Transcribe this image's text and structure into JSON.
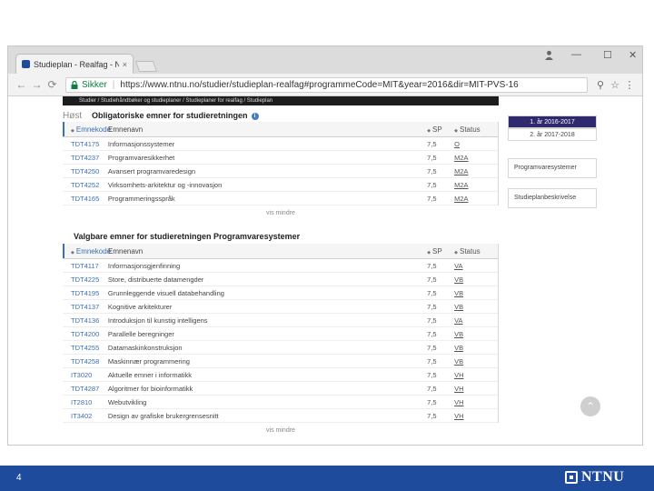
{
  "browser": {
    "tab_title": "Studieplan - Realfag - N",
    "tab_close": "×",
    "window_controls": [
      "—",
      "☐",
      "✕"
    ],
    "nav": {
      "back": "←",
      "forward": "→",
      "reload": "⟳"
    },
    "address": {
      "secure_label": "Sikker",
      "url": "https://www.ntnu.no/studier/studieplan-realfag#programmeCode=MIT&year=2016&dir=MIT-PVS-16"
    },
    "toolbar_icons": {
      "zoom": "⚲",
      "bookmark": "☆",
      "menu": "⋮"
    }
  },
  "page": {
    "breadcrumb": "Studier / Studiehåndbøker og studieplaner / Studieplaner for realfag / Studieplan",
    "season": "Høst",
    "mandatory": {
      "title": "Obligatoriske emner for studieretningen",
      "columns": {
        "code": "Emnekode",
        "name": "Emnenavn",
        "sp": "SP",
        "status": "Status"
      },
      "rows": [
        {
          "code": "TDT4175",
          "name": "Informasjonssystemer",
          "sp": "7,5",
          "status": "O"
        },
        {
          "code": "TDT4237",
          "name": "Programvaresikkerhet",
          "sp": "7,5",
          "status": "M2A"
        },
        {
          "code": "TDT4250",
          "name": "Avansert programvaredesign",
          "sp": "7,5",
          "status": "M2A"
        },
        {
          "code": "TDT4252",
          "name": "Virksomhets-arkitektur og -innovasjon",
          "sp": "7,5",
          "status": "M2A"
        },
        {
          "code": "TDT4165",
          "name": "Programmeringsspråk",
          "sp": "7,5",
          "status": "M2A"
        }
      ],
      "more": "vis mindre"
    },
    "elective": {
      "title": "Valgbare emner for studieretningen Programvaresystemer",
      "columns": {
        "code": "Emnekode",
        "name": "Emnenavn",
        "sp": "SP",
        "status": "Status"
      },
      "rows": [
        {
          "code": "TDT4117",
          "name": "Informasjonsgjenfinning",
          "sp": "7,5",
          "status": "VA"
        },
        {
          "code": "TDT4225",
          "name": "Store, distribuerte datamengder",
          "sp": "7,5",
          "status": "VB"
        },
        {
          "code": "TDT4195",
          "name": "Grunnleggende visuell databehandling",
          "sp": "7,5",
          "status": "VB"
        },
        {
          "code": "TDT4137",
          "name": "Kognitive arkitekturer",
          "sp": "7,5",
          "status": "VB"
        },
        {
          "code": "TDT4136",
          "name": "Introduksjon til kunstig intelligens",
          "sp": "7,5",
          "status": "VA"
        },
        {
          "code": "TDT4200",
          "name": "Parallelle beregninger",
          "sp": "7,5",
          "status": "VB"
        },
        {
          "code": "TDT4255",
          "name": "Datamaskinkonstruksjon",
          "sp": "7,5",
          "status": "VB"
        },
        {
          "code": "TDT4258",
          "name": "Maskinnær programmering",
          "sp": "7,5",
          "status": "VB"
        },
        {
          "code": "IT3020",
          "name": "Aktuelle emner i informatikk",
          "sp": "7,5",
          "status": "VH"
        },
        {
          "code": "TDT4287",
          "name": "Algoritmer for bioinformatikk",
          "sp": "7,5",
          "status": "VH"
        },
        {
          "code": "IT2810",
          "name": "Webutvikling",
          "sp": "7,5",
          "status": "VH"
        },
        {
          "code": "IT3402",
          "name": "Design av grafiske brukergrensesnitt",
          "sp": "7,5",
          "status": "VH"
        }
      ],
      "more": "vis mindre"
    },
    "years": [
      "1. år 2016-2017",
      "2. år 2017-2018"
    ],
    "side_links": [
      "Programvaresystemer",
      "Studieplanbeskrivelse"
    ],
    "sort_glyph": "◆",
    "info_glyph": "i",
    "scroll_up_glyph": "⌃"
  },
  "slide": {
    "number": "4",
    "logo_text": "NTNU",
    "colors": {
      "footer": "#1e4b9c",
      "active_year": "#2f2a6e",
      "link": "#3b6fb6"
    }
  }
}
